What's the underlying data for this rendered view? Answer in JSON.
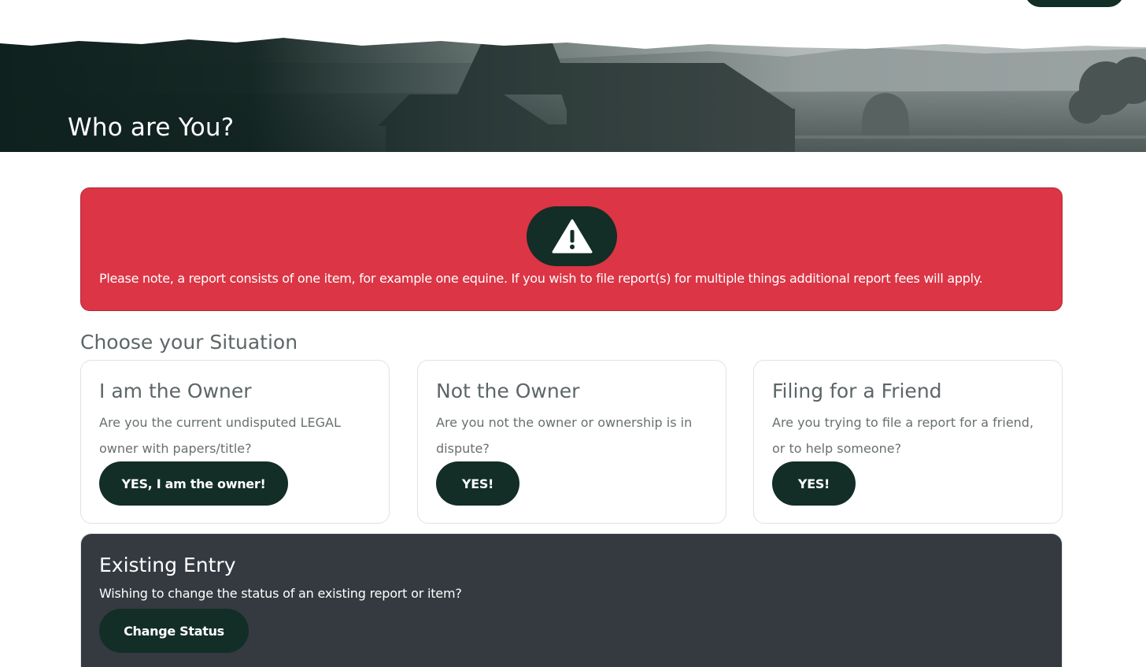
{
  "hero": {
    "title": "Who are You?"
  },
  "alert": {
    "icon": "warning-triangle-icon",
    "text": "Please note, a report consists of one item, for example one equine. If you wish to file report(s) for multiple things additional report fees will apply."
  },
  "situation": {
    "heading": "Choose your Situation",
    "cards": [
      {
        "title": "I am the Owner",
        "text": "Are you the current undisputed LEGAL owner with papers/title?",
        "button": "YES, I am the owner!"
      },
      {
        "title": "Not the Owner",
        "text": "Are you not the owner or ownership is in dispute?",
        "button": "YES!"
      },
      {
        "title": "Filing for a Friend",
        "text": "Are you trying to file a report for a friend, or to help someone?",
        "button": "YES!"
      }
    ]
  },
  "existing": {
    "title": "Existing Entry",
    "text": "Wishing to change the status of an existing report or item?",
    "button": "Change Status"
  },
  "colors": {
    "accent_dark": "#132d27",
    "alert_red": "#dc3545",
    "panel_dark": "#343a40",
    "muted_text": "#5d6667"
  }
}
